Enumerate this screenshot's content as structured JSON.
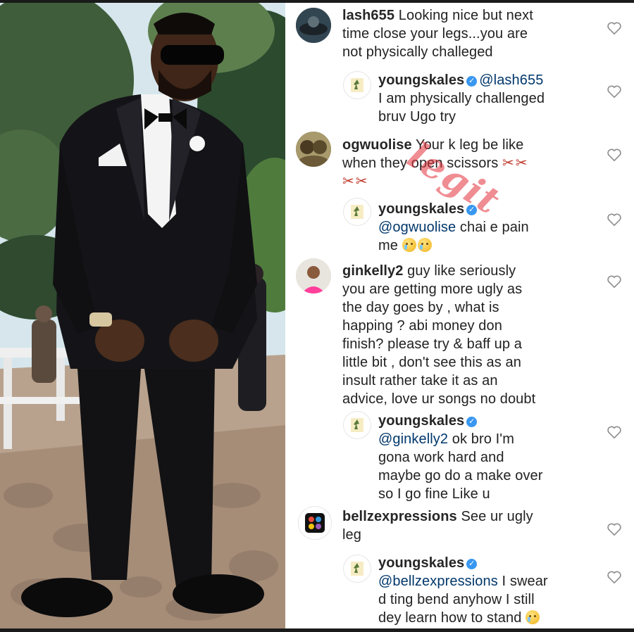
{
  "post": {
    "photo_alt": "man in black tuxedo with bow tie and sunglasses standing on stone path"
  },
  "watermark": "legit",
  "colors": {
    "username": "#262626",
    "mention": "#00376b",
    "verified_badge": "#3897f0",
    "watermark": "#e2303a",
    "heart_outline": "#8e8e8e"
  },
  "comments": [
    {
      "username": "lash655",
      "text_lines": [
        "Looking nice but next",
        "time  close your legs...you are",
        "not physically  challeged"
      ],
      "avatar": "lash655-avatar",
      "verified": false
    },
    {
      "username": "youngskales",
      "verified": true,
      "mention": "@lash655",
      "text_lines": [
        "I am physically challenged",
        "bruv Ugo try"
      ],
      "avatar": "youngskales-avatar"
    },
    {
      "username": "ogwuolise",
      "text_lines": [
        "Your k leg be like",
        "when they open scissors"
      ],
      "emoji_suffix": "✂✂",
      "emoji_line2": "✂✂",
      "avatar": "ogwuolise-avatar",
      "verified": false
    },
    {
      "username": "youngskales",
      "verified": true,
      "mention": "@ogwuolise",
      "text_lines": [
        "chai e pain",
        "me"
      ],
      "avatar": "youngskales-avatar"
    },
    {
      "username": "ginkelly2",
      "text_lines": [
        "guy like seriously",
        "you are getting more ugly as",
        "the day goes by , what is",
        "happing ? abi money don",
        "finish? please try & baff up a",
        "little bit , don't see this as an",
        "insult rather take it as an",
        "advice, love ur songs no doubt"
      ],
      "avatar": "ginkelly2-avatar",
      "verified": false
    },
    {
      "username": "youngskales",
      "verified": true,
      "mention": "@ginkelly2",
      "text_lines": [
        "ok bro I'm",
        "gona work hard and",
        "maybe go do a make over",
        "so I go fine Like u"
      ],
      "avatar": "youngskales-avatar"
    },
    {
      "username": "bellzexpressions",
      "text_lines": [
        "See ur ugly",
        "leg"
      ],
      "avatar": "bellzexpressions-avatar",
      "verified": false
    },
    {
      "username": "youngskales",
      "verified": true,
      "mention": "@bellzexpressions",
      "text_lines": [
        "I swear",
        "d ting bend anyhow I still",
        "dey learn how to stand"
      ],
      "avatar": "youngskales-avatar"
    }
  ]
}
